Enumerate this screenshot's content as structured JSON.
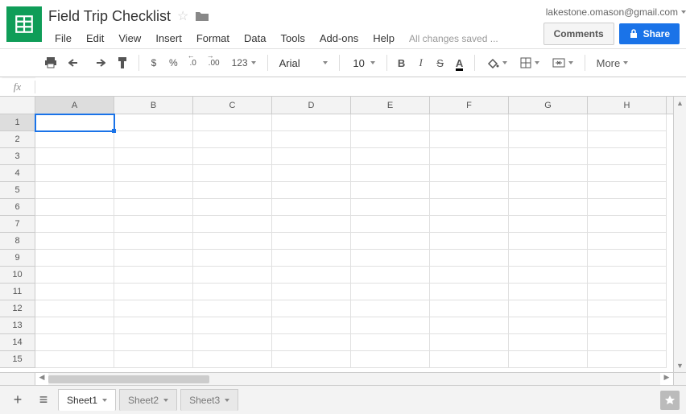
{
  "doc": {
    "title": "Field Trip Checklist",
    "save_status": "All changes saved ..."
  },
  "user": {
    "email": "lakestone.omason@gmail.com"
  },
  "buttons": {
    "comments": "Comments",
    "share": "Share"
  },
  "menubar": [
    "File",
    "Edit",
    "View",
    "Insert",
    "Format",
    "Data",
    "Tools",
    "Add-ons",
    "Help"
  ],
  "toolbar": {
    "currency": "$",
    "percent": "%",
    "dec_dec": ".0",
    "inc_dec": ".00",
    "num_fmt": "123",
    "font": "Arial",
    "font_size": "10",
    "bold": "B",
    "italic": "I",
    "strike": "S",
    "textcolor": "A",
    "more": "More"
  },
  "fx": {
    "label": "fx",
    "value": ""
  },
  "columns": [
    "A",
    "B",
    "C",
    "D",
    "E",
    "F",
    "G",
    "H"
  ],
  "rows": [
    "1",
    "2",
    "3",
    "4",
    "5",
    "6",
    "7",
    "8",
    "9",
    "10",
    "11",
    "12",
    "13",
    "14",
    "15"
  ],
  "active_cell": {
    "row": 0,
    "col": 0
  },
  "sheets": [
    {
      "name": "Sheet1",
      "active": true
    },
    {
      "name": "Sheet2",
      "active": false
    },
    {
      "name": "Sheet3",
      "active": false
    }
  ]
}
